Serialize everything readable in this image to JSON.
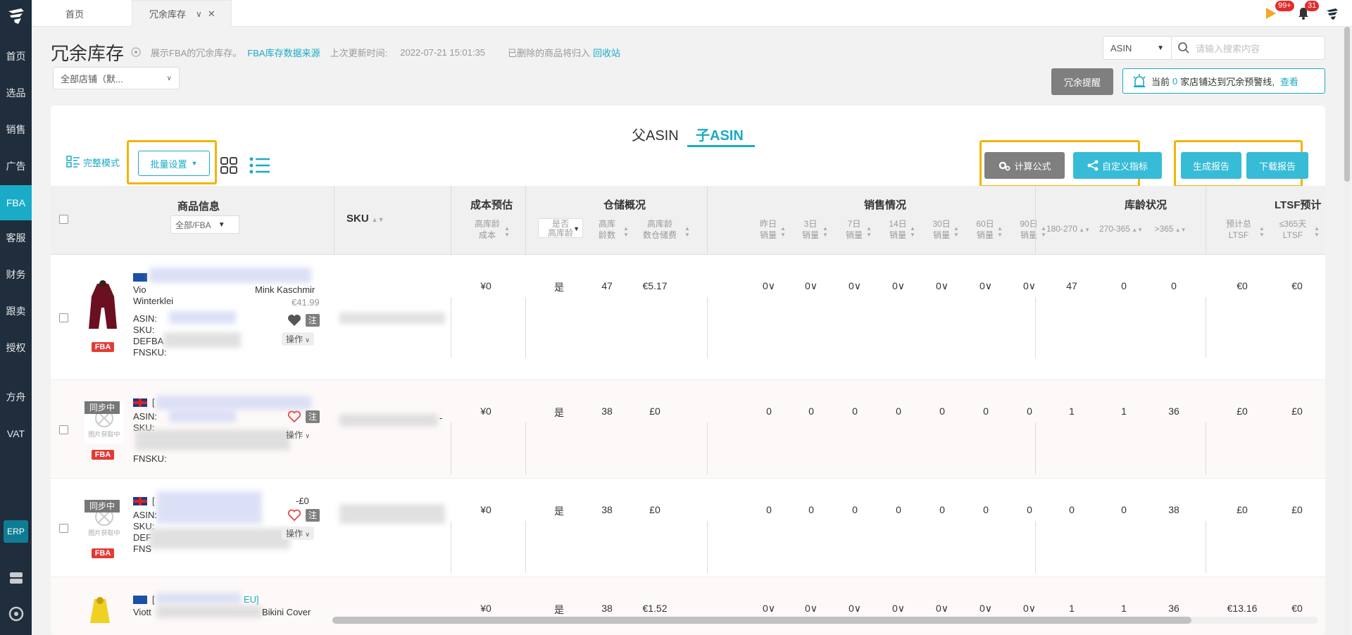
{
  "sidebar": {
    "items": [
      {
        "label": "首页"
      },
      {
        "label": "选品"
      },
      {
        "label": "销售"
      },
      {
        "label": "广告"
      },
      {
        "label": "FBA"
      },
      {
        "label": "客服"
      },
      {
        "label": "财务"
      },
      {
        "label": "跟卖"
      },
      {
        "label": "授权"
      },
      {
        "label": "方舟"
      },
      {
        "label": "VAT"
      }
    ],
    "erp_label": "ERP"
  },
  "tabs": {
    "home": "首页",
    "current": "冗余库存"
  },
  "topbar": {
    "badge_a": "99+",
    "badge_b": "31"
  },
  "header": {
    "title": "冗余库存",
    "desc": "展示FBA的冗余库存。",
    "source_link": "FBA库存数据来源",
    "update_label": "上次更新时间:",
    "update_time": "2022-07-21 15:01:35",
    "deleted_note": "已删除的商品将归入",
    "recycle_link": "回收站"
  },
  "store_select": "全部店铺（默...",
  "search": {
    "type": "ASIN",
    "placeholder": "请输入搜索内容"
  },
  "alert": {
    "button": "冗余提醒",
    "text_pre": "当前",
    "count": "0",
    "text_post": "家店铺达到冗余预警线,",
    "view": "查看"
  },
  "card": {
    "mode_tabs": [
      "父ASIN",
      "子ASIN"
    ],
    "view_mode": "完整模式",
    "batch": "批量设置",
    "formula": "计算公式",
    "custom_metric": "自定义指标",
    "gen_report": "生成报告",
    "download_report": "下载报告"
  },
  "table": {
    "headers": {
      "product": "商品信息",
      "product_filter": "全部/FBA",
      "sku": "SKU",
      "cost": "成本预估",
      "cost_sub1": "高库龄",
      "cost_sub2": "成本",
      "warehouse": "仓储概况",
      "wh_is_sub1": "是否",
      "wh_is_sub2": "高库龄",
      "wh_qty_sub1": "高库",
      "wh_qty_sub2": "龄数",
      "wh_fee_sub1": "高库龄",
      "wh_fee_sub2": "数仓储费",
      "sales": "销售情况",
      "sales_subs": [
        [
          "昨日",
          "销量"
        ],
        [
          "3日",
          "销量"
        ],
        [
          "7日",
          "销量"
        ],
        [
          "14日",
          "销量"
        ],
        [
          "30日",
          "销量"
        ],
        [
          "60日",
          "销量"
        ],
        [
          "90日",
          "销量"
        ]
      ],
      "age": "库龄状况",
      "age_subs": [
        "180-270",
        "270-365",
        ">365"
      ],
      "ltsf": "LTSF预计",
      "ltsf_sub1a": "预计总",
      "ltsf_sub1b": "LTSF",
      "ltsf_sub2a": "≤365天",
      "ltsf_sub2b": "LTSF"
    },
    "rows": [
      {
        "title_a": "Vio",
        "title_b": "Mink Kaschmir",
        "title_c": "Winterklei",
        "price": "€41.99",
        "asin_label": "ASIN:",
        "sku_label": "SKU:",
        "extra_label": "DEFBA",
        "fnsku_label": "FNSKU:",
        "op": "操作",
        "note": "注",
        "cost": "¥0",
        "is_aged": "是",
        "aged_qty": "47",
        "aged_fee": "€5.17",
        "sales": [
          "0∨",
          "0∨",
          "0∨",
          "0∨",
          "0∨",
          "0∨",
          "0∨"
        ],
        "age": [
          "47",
          "0",
          "0"
        ],
        "ltsf": [
          "€0",
          "€0"
        ]
      },
      {
        "sync": "同步中",
        "img_text": "图片获取中",
        "title_a": "[",
        "asin_label": "ASIN:",
        "sku_label": "SKU:",
        "fnsku_label": "FNSKU:",
        "op": "操作",
        "note": "注",
        "sku_tail": "-",
        "cost": "¥0",
        "is_aged": "是",
        "aged_qty": "38",
        "aged_fee": "£0",
        "sales": [
          "0",
          "0",
          "0",
          "0",
          "0",
          "0",
          "0"
        ],
        "age": [
          "1",
          "1",
          "36"
        ],
        "ltsf": [
          "£0",
          "£0"
        ]
      },
      {
        "sync": "同步中",
        "img_text": "图片获取中",
        "title_a": "[",
        "title_b": "-£0",
        "asin_label": "ASIN:",
        "sku_label": "SKU:",
        "extra_label": "DEF",
        "fnsku_label": "FNS",
        "op": "操作",
        "note": "注",
        "cost": "¥0",
        "is_aged": "是",
        "aged_qty": "38",
        "aged_fee": "£0",
        "sales": [
          "0",
          "0",
          "0",
          "0",
          "0",
          "0",
          "0"
        ],
        "age": [
          "0",
          "0",
          "38"
        ],
        "ltsf": [
          "£0",
          "£0"
        ]
      },
      {
        "title_a": "[",
        "title_b": "EU]",
        "title_c": "Viott",
        "title_d": "Bikini Cover",
        "cost": "¥0",
        "is_aged": "是",
        "aged_qty": "38",
        "aged_fee": "€1.52",
        "sales": [
          "0∨",
          "0∨",
          "0∨",
          "0∨",
          "0∨",
          "0∨",
          "0∨"
        ],
        "age": [
          "1",
          "1",
          "36"
        ],
        "ltsf": [
          "€13.16",
          "€0"
        ]
      }
    ]
  },
  "colors": {
    "sidebar_bg": "#1f2d3d",
    "accent": "#1aabc7",
    "highlight": "#f5b301",
    "fba_red": "#e53935"
  }
}
